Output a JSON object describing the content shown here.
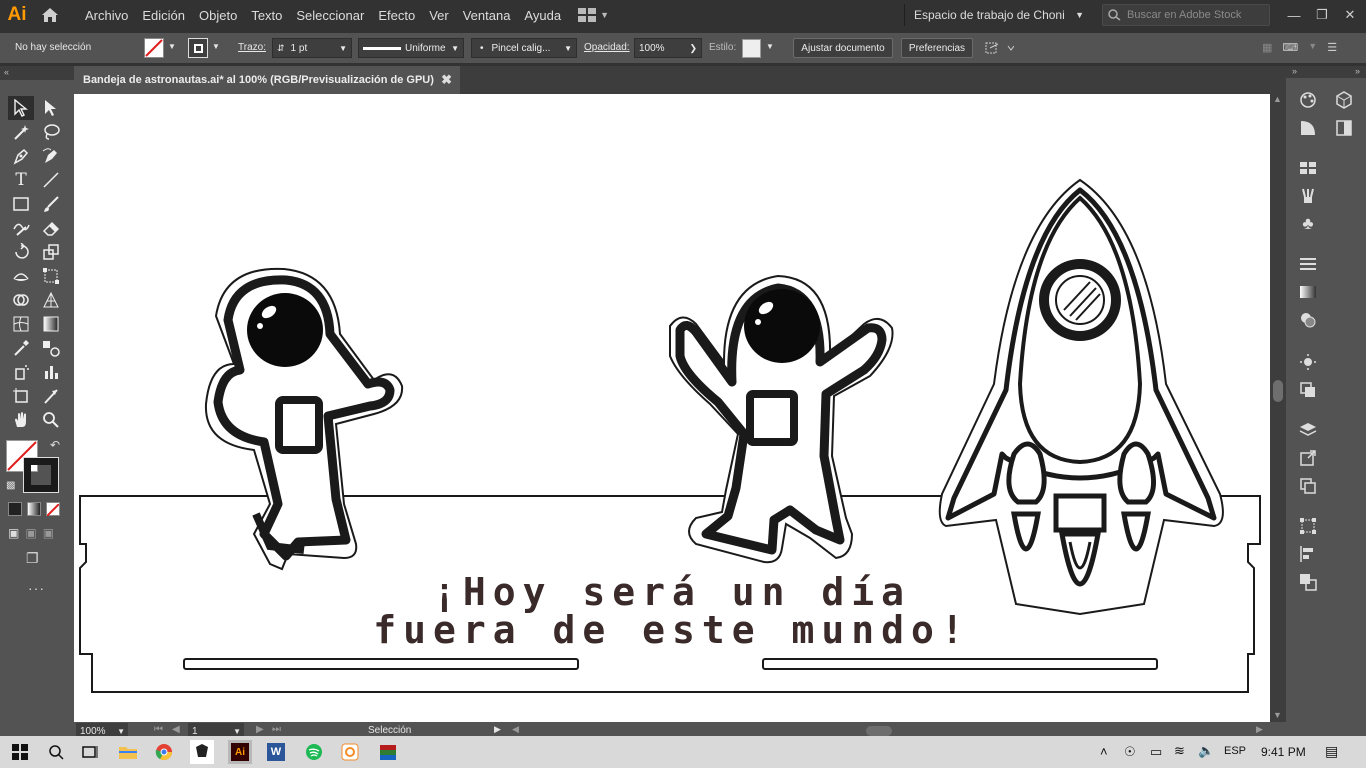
{
  "app": {
    "logo": "Ai"
  },
  "menu": [
    "Archivo",
    "Edición",
    "Objeto",
    "Texto",
    "Seleccionar",
    "Efecto",
    "Ver",
    "Ventana",
    "Ayuda"
  ],
  "workspace": {
    "label": "Espacio de trabajo de Choni"
  },
  "stock": {
    "placeholder": "Buscar en Adobe Stock"
  },
  "control": {
    "selection": "No hay selección",
    "stroke_label": "Trazo:",
    "stroke_value": "1 pt",
    "profile": "Uniforme",
    "brush": "Pincel calig...",
    "opacity_label": "Opacidad:",
    "opacity_value": "100%",
    "style_label": "Estilo:",
    "fit_button": "Ajustar documento",
    "prefs_button": "Preferencias"
  },
  "document": {
    "tab_title": "Bandeja de astronautas.ai* al 100% (RGB/Previsualización de GPU)"
  },
  "canvas": {
    "line1": "¡Hoy será un día",
    "line2": "fuera de este mundo!"
  },
  "status": {
    "zoom": "100%",
    "artboard": "1",
    "tool": "Selección"
  },
  "taskbar": {
    "lang": "ESP",
    "time": "9:41 PM"
  },
  "icons": {
    "logo_color": "#ff9a00"
  }
}
